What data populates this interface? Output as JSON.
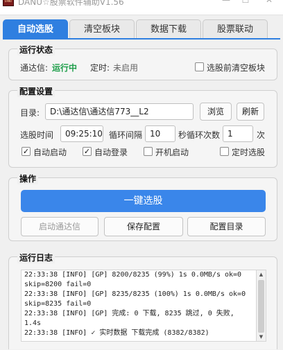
{
  "window": {
    "title": "DANU☆股票软件辅助V1.56",
    "icon_text": "DANU",
    "minimize": "—",
    "maximize": "☐",
    "close": "✕"
  },
  "tabs": [
    {
      "label": "自动选股",
      "active": true
    },
    {
      "label": "清空板块",
      "active": false
    },
    {
      "label": "数据下载",
      "active": false
    },
    {
      "label": "股票联动",
      "active": false
    }
  ],
  "status": {
    "title": "运行状态",
    "tdx_label": "通达信:",
    "tdx_value": "运行中",
    "timer_label": "定时:",
    "timer_value": "未启用",
    "clear_before_label": "选股前清空板块",
    "clear_before_checked": false
  },
  "config": {
    "title": "配置设置",
    "dir_label": "目录:",
    "dir_value": "D:\\通达信\\通达信773__L2",
    "browse_label": "浏览",
    "refresh_label": "刷新",
    "time_label": "选股时间",
    "time_value": "09:25:10",
    "interval_label": "循环间隔",
    "interval_value": "10",
    "count_label": "秒循环次数",
    "count_value": "1",
    "count_unit": "次",
    "auto_start_label": "自动启动",
    "auto_start_checked": true,
    "auto_login_label": "自动登录",
    "auto_login_checked": true,
    "boot_start_label": "开机启动",
    "boot_start_checked": false,
    "timed_select_label": "定时选股",
    "timed_select_checked": false
  },
  "actions": {
    "title": "操作",
    "one_click_label": "一键选股",
    "start_tdx_label": "启动通达信",
    "save_config_label": "保存配置",
    "config_dir_label": "配置目录"
  },
  "log": {
    "title": "运行日志",
    "lines": [
      "22:33:38 [INFO] [GP] 8200/8235 (99%) 1s 0.0MB/s ok=0 skip=8200 fail=0",
      "22:33:38 [INFO] [GP] 8235/8235 (100%) 1s 0.0MB/s ok=0 skip=8235 fail=0",
      "22:33:38 [INFO] [GP] 完成: 0 下载, 8235 跳过, 0 失败, 1.4s",
      "22:33:38 [INFO] ✓ 实时数据 下载完成 (8382/8382)"
    ],
    "scroll_up": "▲",
    "scroll_down": "▼"
  }
}
